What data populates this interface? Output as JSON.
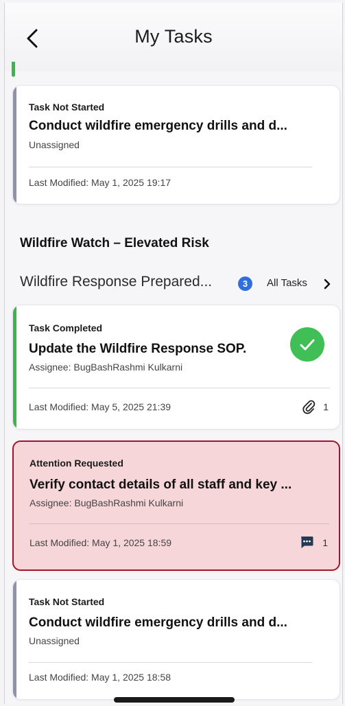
{
  "header": {
    "title": "My Tasks"
  },
  "cards": [
    {
      "status": "Task Not Started",
      "name": "Conduct wildfire emergency drills and d...",
      "sub": "Unassigned",
      "modified": "Last Modified: May 1, 2025 19:17",
      "bar_color": "#8e93ab"
    },
    {
      "status": "Task Completed",
      "name": "Update the Wildfire Response SOP.",
      "sub": "Assignee: BugBashRashmi Kulkarni",
      "modified": "Last Modified: May 5, 2025 21:39",
      "count": "1",
      "bar_color": "#3db54a",
      "icon": "paperclip-icon"
    },
    {
      "status": "Attention Requested",
      "name": "Verify contact details of all staff and key ...",
      "sub": "Assignee: BugBashRashmi Kulkarni",
      "modified": "Last Modified: May 1, 2025 18:59",
      "count": "1",
      "bar_color": "#a3132a",
      "icon": "comment-icon"
    },
    {
      "status": "Task Not Started",
      "name": "Conduct wildfire emergency drills and d...",
      "sub": "Unassigned",
      "modified": "Last Modified: May 1, 2025 18:58",
      "bar_color": "#8e93ab"
    }
  ],
  "section": {
    "title": "Wildfire Watch – Elevated Risk",
    "plan_name": "Wildfire Response Prepared...",
    "task_count": "3",
    "all_tasks_label": "All Tasks"
  },
  "colors": {
    "completed": "#3fbf56",
    "attention": "#a3132a",
    "attention_bg": "#f6d6d9",
    "badge": "#2f6fdc"
  }
}
